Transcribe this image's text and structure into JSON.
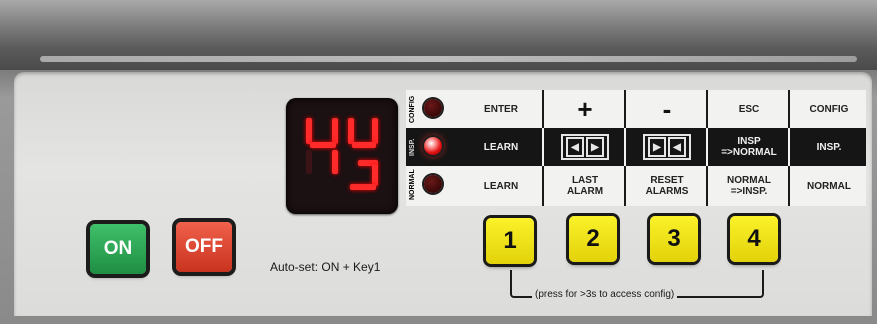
{
  "display": {
    "readout": "43"
  },
  "rows": {
    "config": {
      "side_label": "CONFIG",
      "led_state": "off",
      "cells": [
        "ENTER",
        "+",
        "-",
        "ESC",
        "CONFIG"
      ]
    },
    "insp": {
      "side_label": "INSP.",
      "led_state": "on",
      "cells": [
        "LEARN",
        "",
        "",
        "INSP\n=>NORMAL",
        "INSP."
      ]
    },
    "normal": {
      "side_label": "NORMAL",
      "led_state": "off",
      "cells": [
        "LEARN",
        "LAST\nALARM",
        "RESET\nALARMS",
        "NORMAL\n=>INSP.",
        "NORMAL"
      ]
    }
  },
  "buttons": {
    "on_label": "ON",
    "off_label": "OFF"
  },
  "keys": [
    "1",
    "2",
    "3",
    "4"
  ],
  "autoset_text": "Auto-set: ON + Key1",
  "config_hint": "(press for >3s to access config)",
  "colors": {
    "led_on": "#ff2a2a",
    "key_yellow": "#f5e91a",
    "on_green": "#2aa855",
    "off_red": "#e14a36"
  }
}
